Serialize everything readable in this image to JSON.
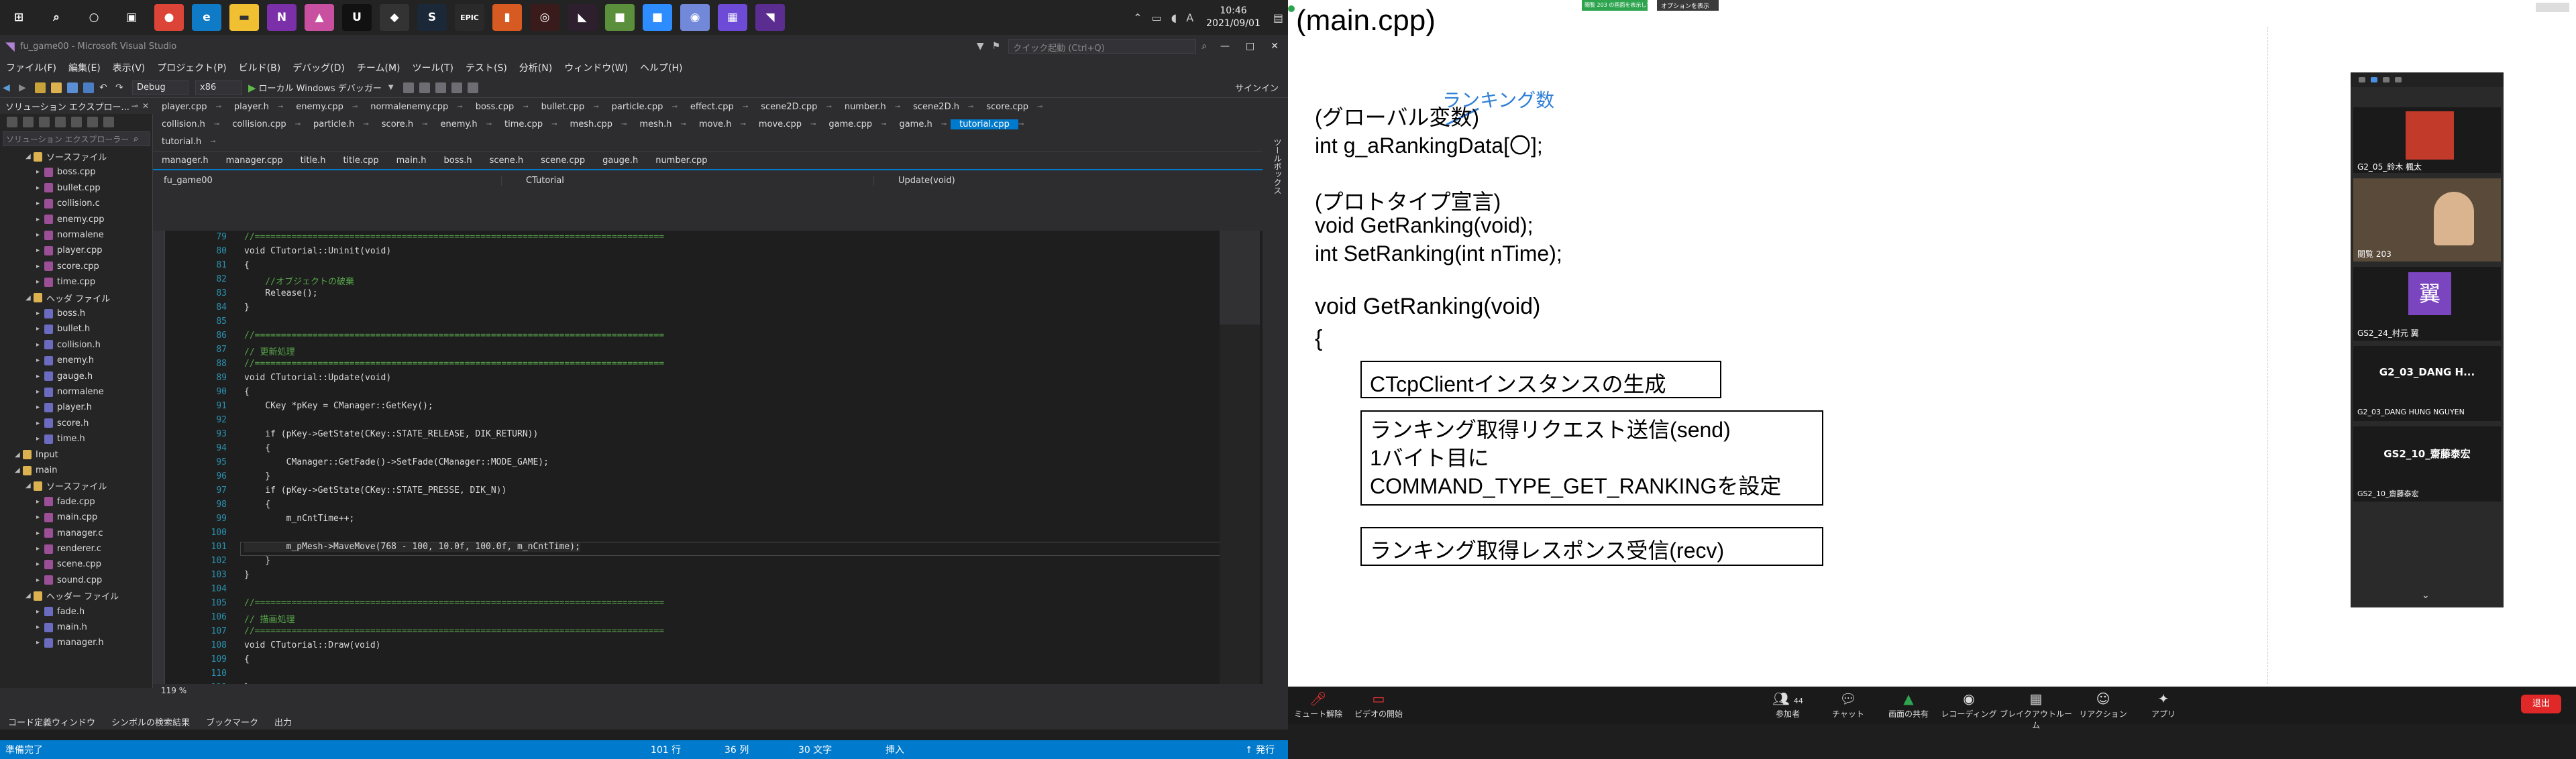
{
  "taskbar": {
    "clock_time": "10:46",
    "clock_date": "2021/09/01",
    "ime": "A"
  },
  "vs": {
    "title": "fu_game00 - Microsoft Visual Studio",
    "search_placeholder": "クイック起動 (Ctrl+Q)",
    "signin": "サインイン",
    "menu": [
      "ファイル(F)",
      "編集(E)",
      "表示(V)",
      "プロジェクト(P)",
      "ビルド(B)",
      "デバッグ(D)",
      "チーム(M)",
      "ツール(T)",
      "テスト(S)",
      "分析(N)",
      "ウィンドウ(W)",
      "ヘルプ(H)"
    ],
    "toolbar": {
      "config": "Debug",
      "platform": "x86",
      "run": "ローカル Windows デバッガー"
    },
    "solution": {
      "title": "ソリューション エクスプロー...",
      "search_placeholder": "ソリューション エクスプローラー",
      "items": [
        "ソースファイル",
        "boss.cpp",
        "bullet.cpp",
        "collision.c",
        "enemy.cpp",
        "normalene",
        "player.cpp",
        "score.cpp",
        "time.cpp",
        "ヘッダ ファイル",
        "boss.h",
        "bullet.h",
        "collision.h",
        "enemy.h",
        "gauge.h",
        "normalene",
        "player.h",
        "score.h",
        "time.h",
        "Input",
        "main",
        "ソースファイル",
        "fade.cpp",
        "main.cpp",
        "manager.c",
        "renderer.c",
        "scene.cpp",
        "sound.cpp",
        "ヘッダー ファイル",
        "fade.h",
        "main.h",
        "manager.h"
      ]
    },
    "side_tab": "ツールボックス",
    "tabs": {
      "row1": [
        "player.cpp",
        "player.h",
        "enemy.cpp",
        "normalenemy.cpp",
        "boss.cpp",
        "bullet.cpp",
        "particle.cpp",
        "effect.cpp",
        "scene2D.cpp",
        "number.h",
        "scene2D.h",
        "score.cpp"
      ],
      "row2": [
        "collision.h",
        "collision.cpp",
        "particle.h",
        "score.h",
        "enemy.h",
        "time.cpp",
        "mesh.cpp",
        "mesh.h",
        "move.h",
        "move.cpp",
        "game.cpp",
        "game.h",
        "tutorial.cpp"
      ],
      "row3": [
        "tutorial.h"
      ],
      "row4": [
        "manager.h",
        "manager.cpp",
        "title.h",
        "title.cpp",
        "main.h",
        "boss.h",
        "scene.h",
        "scene.cpp",
        "gauge.h",
        "number.cpp"
      ]
    },
    "nav": {
      "project": "fu_game00",
      "scope": "CTutorial",
      "member": "Update(void)"
    },
    "code": [
      {
        "n": "79",
        "t": "//=============================================================================="
      },
      {
        "n": "80",
        "t": "void CTutorial::Uninit(void)"
      },
      {
        "n": "81",
        "t": "{"
      },
      {
        "n": "82",
        "t": "    //オブジェクトの破棄"
      },
      {
        "n": "83",
        "t": "    Release();"
      },
      {
        "n": "84",
        "t": "}"
      },
      {
        "n": "85",
        "t": ""
      },
      {
        "n": "86",
        "t": "//=============================================================================="
      },
      {
        "n": "87",
        "t": "// 更新処理"
      },
      {
        "n": "88",
        "t": "//=============================================================================="
      },
      {
        "n": "89",
        "t": "void CTutorial::Update(void)"
      },
      {
        "n": "90",
        "t": "{"
      },
      {
        "n": "91",
        "t": "    CKey *pKey = CManager::GetKey();"
      },
      {
        "n": "92",
        "t": ""
      },
      {
        "n": "93",
        "t": "    if (pKey->GetState(CKey::STATE_RELEASE, DIK_RETURN))"
      },
      {
        "n": "94",
        "t": "    {"
      },
      {
        "n": "95",
        "t": "        CManager::GetFade()->SetFade(CManager::MODE_GAME);"
      },
      {
        "n": "96",
        "t": "    }"
      },
      {
        "n": "97",
        "t": "    if (pKey->GetState(CKey::STATE_PRESSE, DIK_N))"
      },
      {
        "n": "98",
        "t": "    {"
      },
      {
        "n": "99",
        "t": "        m_nCntTime++;"
      },
      {
        "n": "100",
        "t": ""
      },
      {
        "n": "101",
        "t": "        m_pMesh->MaveMove(768 - 100, 10.0f, 100.0f, m_nCntTime);"
      },
      {
        "n": "102",
        "t": "    }"
      },
      {
        "n": "103",
        "t": "}"
      },
      {
        "n": "104",
        "t": ""
      },
      {
        "n": "105",
        "t": "//=============================================================================="
      },
      {
        "n": "106",
        "t": "// 描画処理"
      },
      {
        "n": "107",
        "t": "//=============================================================================="
      },
      {
        "n": "108",
        "t": "void CTutorial::Draw(void)"
      },
      {
        "n": "109",
        "t": "{"
      },
      {
        "n": "110",
        "t": ""
      },
      {
        "n": "111",
        "t": "}"
      }
    ],
    "zoom": "119 %",
    "bottom_tabs": [
      "コード定義ウィンドウ",
      "シンボルの検索結果",
      "ブックマーク",
      "出力"
    ],
    "status": {
      "ready": "準備完了",
      "line": "101 行",
      "col": "36 列",
      "chars": "30 文字",
      "ins": "挿入",
      "publish": "↑ 発行"
    }
  },
  "zoom": {
    "share_banner": "閲覧 203 の画面を表示しています",
    "options": "オプションを表示",
    "slide": {
      "title": "(main.cpp)",
      "annotation": "ランキング数",
      "global_comment": "(グローバル変数)",
      "global_decl": "int g_aRankingData[〇];",
      "proto_comment": "(プロトタイプ宣言)",
      "proto1": "void GetRanking(void);",
      "proto2": "int SetRanking(int nTime);",
      "func_head": "void GetRanking(void)",
      "brace": "{",
      "box1": "CTcpClientインスタンスの生成",
      "box2_l1": "ランキング取得リクエスト送信(send)",
      "box2_l2": "1バイト目に",
      "box2_l3": "COMMAND_TYPE_GET_RANKINGを設定",
      "box3": "ランキング取得レスポンス受信(recv)"
    },
    "participants": [
      {
        "name": "G2_05_鈴木 楓太",
        "kind": "photo"
      },
      {
        "name": "閲覧 203",
        "kind": "video"
      },
      {
        "name": "GS2_24_村元 翼",
        "kind": "avatar",
        "initial": "翼"
      },
      {
        "name": "G2_03_DANG HUNG NGUYEN",
        "kind": "text",
        "big": "G2_03_DANG H..."
      },
      {
        "name": "GS2_10_齋藤泰宏",
        "kind": "text",
        "big": "GS2_10_齋藤泰宏"
      }
    ],
    "controls": {
      "mute": "ミュート解除",
      "video": "ビデオの開始",
      "participants": "参加者",
      "participants_count": "44",
      "chat": "チャット",
      "share": "画面の共有",
      "record": "レコーディング",
      "breakout": "ブレイクアウトルーム",
      "reaction": "リアクション",
      "apps": "アプリ",
      "leave": "退出"
    }
  }
}
